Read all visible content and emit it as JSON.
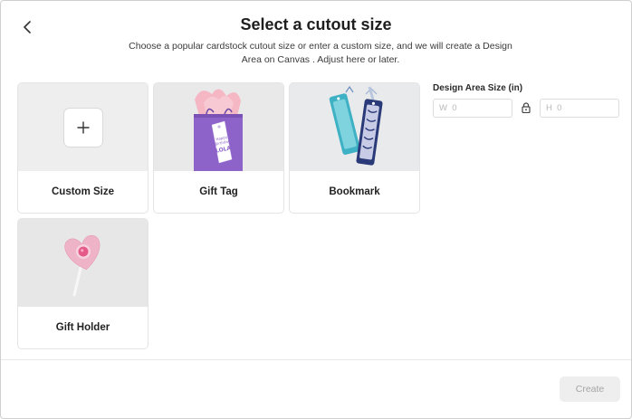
{
  "dialog": {
    "title": "Select a cutout size",
    "subtitle": "Choose a popular cardstock cutout size or enter a custom size, and we will create a Design Area on Canvas . Adjust here or later."
  },
  "cards": [
    {
      "label": "Custom Size",
      "icon": "plus-icon"
    },
    {
      "label": "Gift Tag",
      "icon": "gift-tag-image",
      "tag_text_1": "Happy",
      "tag_text_2": "Birthday",
      "tag_text_3": "LOLA"
    },
    {
      "label": "Bookmark",
      "icon": "bookmark-image"
    },
    {
      "label": "Gift Holder",
      "icon": "gift-holder-image"
    }
  ],
  "size_panel": {
    "title": "Design Area Size  (in)",
    "width_placeholder": "W  0",
    "height_placeholder": "H  0",
    "lock_icon": "lock-icon"
  },
  "footer": {
    "create_label": "Create"
  },
  "colors": {
    "background": "#ffffff",
    "card_image_bg": "#eeeeee",
    "disabled_button_bg": "#eeeeee",
    "disabled_button_text": "#a5a5a5",
    "gift_bag_purple": "#8d63c9",
    "tissue_pink": "#f4b7c3",
    "bookmark_teal": "#3fb1c4",
    "bookmark_navy": "#2a3a78",
    "heart_pink": "#efb3c7"
  }
}
